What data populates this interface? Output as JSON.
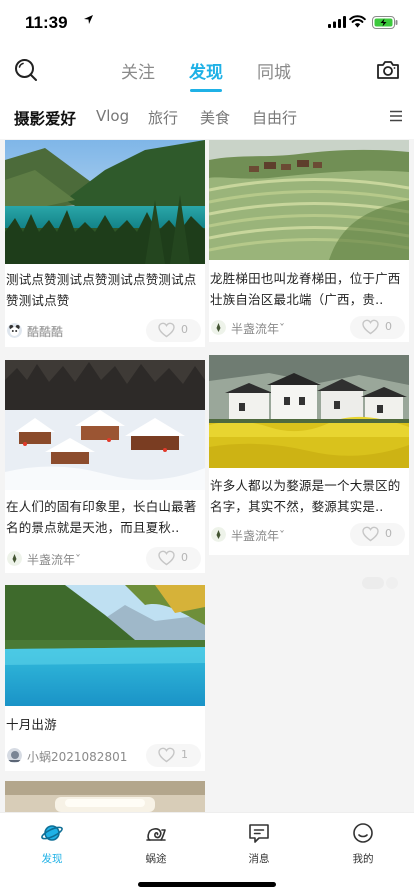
{
  "status": {
    "time": "11:39"
  },
  "header": {
    "tabs": [
      {
        "label": "关注",
        "active": false
      },
      {
        "label": "发现",
        "active": true
      },
      {
        "label": "同城",
        "active": false
      }
    ],
    "accent_color": "#1fb1e6"
  },
  "categories": [
    {
      "label": "摄影爱好",
      "active": true
    },
    {
      "label": "Vlog",
      "active": false
    },
    {
      "label": "旅行",
      "active": false
    },
    {
      "label": "美食",
      "active": false
    },
    {
      "label": "自由行",
      "active": false
    }
  ],
  "feed": {
    "left": [
      {
        "title": "测试点赞测试点赞测试点赞测试点赞测试点赞",
        "author": "酷酷酷",
        "likes": "0",
        "image": "lake-valley"
      },
      {
        "title": "在人们的固有印象里，长白山最著名的景点就是天池，而且夏秋..",
        "author": "半盏流年ˇ",
        "likes": "0",
        "image": "snow-village"
      },
      {
        "title": "十月出游",
        "author": "小蜗2021082801",
        "likes": "1",
        "image": "turquoise-lake"
      },
      {
        "title": "",
        "author": "",
        "likes": "",
        "image": "ceiling-lamp"
      }
    ],
    "right": [
      {
        "title": "龙胜梯田也叫龙脊梯田，位于广西壮族自治区最北端（广西，贵..",
        "author": "半盏流年ˇ",
        "likes": "0",
        "image": "rice-terraces"
      },
      {
        "title": "许多人都以为婺源是一个大景区的名字，其实不然，婺源其实是..",
        "author": "半盏流年ˇ",
        "likes": "0",
        "image": "village-flowers"
      }
    ]
  },
  "bottom_nav": [
    {
      "label": "发现",
      "icon": "planet-icon",
      "active": true
    },
    {
      "label": "蜗途",
      "icon": "snail-icon",
      "active": false
    },
    {
      "label": "消息",
      "icon": "message-icon",
      "active": false
    },
    {
      "label": "我的",
      "icon": "face-icon",
      "active": false
    }
  ]
}
